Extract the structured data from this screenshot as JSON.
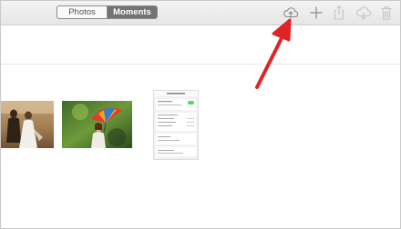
{
  "toolbar": {
    "tabs": [
      {
        "label": "Photos",
        "selected": false
      },
      {
        "label": "Moments",
        "selected": true
      }
    ],
    "tools": [
      "icloud-upload-icon",
      "add-icon",
      "share-icon",
      "icloud-download-icon",
      "trash-icon"
    ]
  },
  "colors": {
    "segment_active": "#737373",
    "annotation_arrow": "#e02424"
  },
  "photos": [
    {
      "subject": "wedding-couple-photo"
    },
    {
      "subject": "woman-with-umbrella-photo"
    },
    {
      "subject": "settings-screenshot-thumbnail"
    }
  ]
}
